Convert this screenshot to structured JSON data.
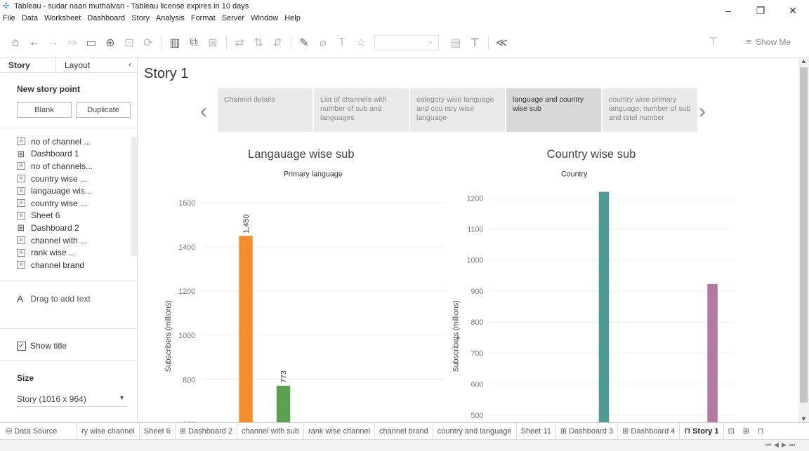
{
  "window": {
    "title": "Tableau - sudar naan muthalvan - Tableau license expires in 10 days",
    "controls": [
      "–",
      "❐",
      "✕"
    ]
  },
  "menu": [
    "File",
    "Data",
    "Worksheet",
    "Dashboard",
    "Story",
    "Analysis",
    "Format",
    "Server",
    "Window",
    "Help"
  ],
  "toolbar": {
    "show_me_label": "Show Me"
  },
  "left_panel": {
    "tabs": [
      "Story",
      "Layout"
    ],
    "new_story_point": "New story point",
    "blank_label": "Blank",
    "duplicate_label": "Duplicate",
    "sheets": [
      {
        "label": "no of channel ...",
        "type": "sheet"
      },
      {
        "label": "Dashboard 1",
        "type": "dashboard"
      },
      {
        "label": "no of channels...",
        "type": "sheet"
      },
      {
        "label": "country wise ...",
        "type": "sheet"
      },
      {
        "label": "langauage wis...",
        "type": "sheet"
      },
      {
        "label": "country wise ...",
        "type": "sheet"
      },
      {
        "label": "Sheet 6",
        "type": "sheet"
      },
      {
        "label": "Dashboard 2",
        "type": "dashboard"
      },
      {
        "label": "channel with ...",
        "type": "sheet"
      },
      {
        "label": "rank wise ...",
        "type": "sheet"
      },
      {
        "label": "channel brand",
        "type": "sheet"
      }
    ],
    "drag_text": "Drag to add text",
    "show_title": "Show title",
    "size_label": "Size",
    "size_value": "Story (1016 x 964)"
  },
  "story": {
    "title": "Story 1",
    "points": [
      "Channel details",
      "List of channels with number of sub and languages",
      "category wise language and cou ntry wise language",
      "language and country wise sub",
      "country wise primary language, number of sub and totel number"
    ],
    "active_point": 3
  },
  "chart_data": [
    {
      "type": "bar",
      "title": "Langauage wise sub",
      "header": "Primary language",
      "ylabel": "Subscribers (millions)",
      "ylim": [
        570,
        1670
      ],
      "yticks": [
        600,
        800,
        1000,
        1200,
        1400,
        1600
      ],
      "values": [
        1450,
        773
      ],
      "data_labels": [
        "1,450",
        "773"
      ],
      "colors": [
        "#f28e2b",
        "#59a14f"
      ]
    },
    {
      "type": "bar",
      "title": "Country wise sub",
      "header": "Country",
      "ylabel": "Subscribers (millions)",
      "ylim": [
        450,
        1235
      ],
      "yticks": [
        500,
        600,
        700,
        800,
        900,
        1000,
        1100,
        1200
      ],
      "values": [
        1220,
        923
      ],
      "colors": [
        "#4e9a94",
        "#b07aa1"
      ]
    }
  ],
  "tabs": [
    {
      "label": "Data Source",
      "icon": "database-icon"
    },
    {
      "label": "ry wise channel"
    },
    {
      "label": "Sheet 6"
    },
    {
      "label": "Dashboard 2",
      "icon": "dashboard-icon"
    },
    {
      "label": "channel with sub"
    },
    {
      "label": "rank wise channel"
    },
    {
      "label": "channel brand"
    },
    {
      "label": "country and language"
    },
    {
      "label": "Sheet 11"
    },
    {
      "label": "Dashboard 3",
      "icon": "dashboard-icon"
    },
    {
      "label": "Dashboard 4",
      "icon": "dashboard-icon"
    },
    {
      "label": "Story 1",
      "icon": "story-icon",
      "active": true
    }
  ]
}
